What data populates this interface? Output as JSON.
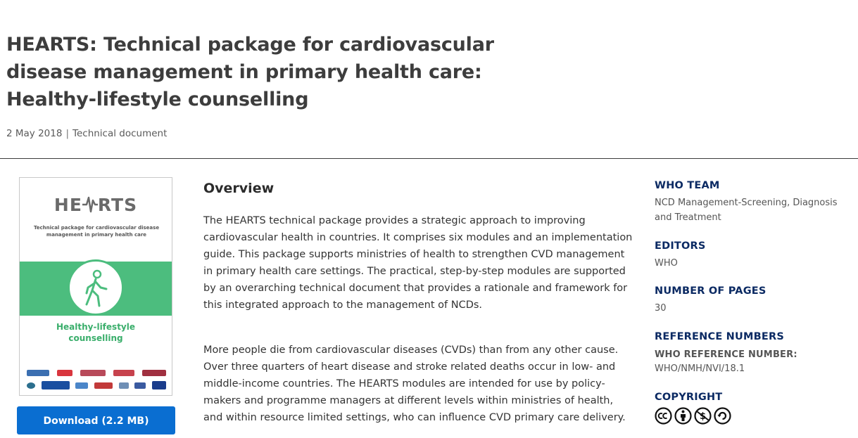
{
  "page": {
    "title": "HEARTS: Technical package for cardiovascular disease management in primary health care: Healthy-lifestyle counselling",
    "date": "2 May 2018",
    "separator": "|",
    "doc_type": "Technical document"
  },
  "cover": {
    "logo_text_left": "HE",
    "logo_text_right": "RTS",
    "subtitle": "Technical package for cardiovascular disease management in primary health care",
    "label_line1": "Healthy-lifestyle",
    "label_line2": "counselling",
    "icon": "walking-person-icon",
    "band_color": "#4cbd7e"
  },
  "download": {
    "label": "Download (2.2 MB)",
    "color": "#0a6ed1"
  },
  "overview": {
    "heading": "Overview",
    "paragraphs": [
      "The HEARTS technical package provides a strategic approach to improving cardiovascular health in countries. It comprises six modules and an implementation guide. This package supports ministries of health to strengthen CVD management in primary health care settings. The practical, step-by-step modules are supported by an overarching technical document that provides a rationale and framework for this integrated approach to the management of NCDs.",
      "More people die from cardiovascular diseases (CVDs) than from any other cause. Over three quarters of heart disease and stroke related deaths occur in low- and middle-income countries. The HEARTS modules are intended for use by policy-makers and programme managers at different levels within ministries of health, and within resource limited settings, who can influence CVD primary care delivery."
    ]
  },
  "sidebar": {
    "who_team": {
      "heading": "WHO TEAM",
      "value": "NCD Management-Screening, Diagnosis and Treatment"
    },
    "editors": {
      "heading": "EDITORS",
      "value": "WHO"
    },
    "pages": {
      "heading": "NUMBER OF PAGES",
      "value": "30"
    },
    "reference": {
      "heading": "REFERENCE NUMBERS",
      "sub_label": "WHO REFERENCE NUMBER:",
      "value": "WHO/NMH/NVI/18.1"
    },
    "copyright": {
      "heading": "COPYRIGHT",
      "icons": [
        "cc-icon",
        "by-icon",
        "nc-icon",
        "sa-icon"
      ]
    }
  },
  "colors": {
    "heading_navy": "#0b2a63",
    "text": "#333333",
    "rule": "#3c3c3c"
  }
}
